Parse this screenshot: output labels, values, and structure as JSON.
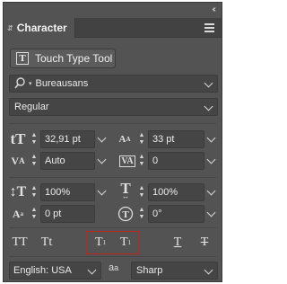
{
  "panel": {
    "title": "Character",
    "collapse_icon": "double-chevron-left-icon",
    "menu_icon": "hamburger-menu-icon"
  },
  "touch_type_tool": {
    "label": "Touch Type Tool"
  },
  "font_family": {
    "value": "Bureausans",
    "icon": "search-icon"
  },
  "font_style": {
    "value": "Regular"
  },
  "font_size": {
    "value": "32,91 pt"
  },
  "leading": {
    "value": "33 pt"
  },
  "kerning": {
    "value": "Auto"
  },
  "tracking": {
    "value": "0"
  },
  "vertical_scale": {
    "value": "100%"
  },
  "horizontal_scale": {
    "value": "100%"
  },
  "baseline_shift": {
    "value": "0 pt"
  },
  "character_rotation": {
    "value": "0°"
  },
  "style_buttons": {
    "all_caps": "TT",
    "small_caps": "Tt",
    "superscript": "T",
    "subscript": "T",
    "underline": "T",
    "strikethrough": "T"
  },
  "language": {
    "value": "English: USA"
  },
  "antialiasing": {
    "icon_text": "a",
    "icon_small": "a",
    "value": "Sharp"
  },
  "colors": {
    "highlight": "#c0241c",
    "panel_bg": "#535353",
    "field_bg": "#454545"
  }
}
